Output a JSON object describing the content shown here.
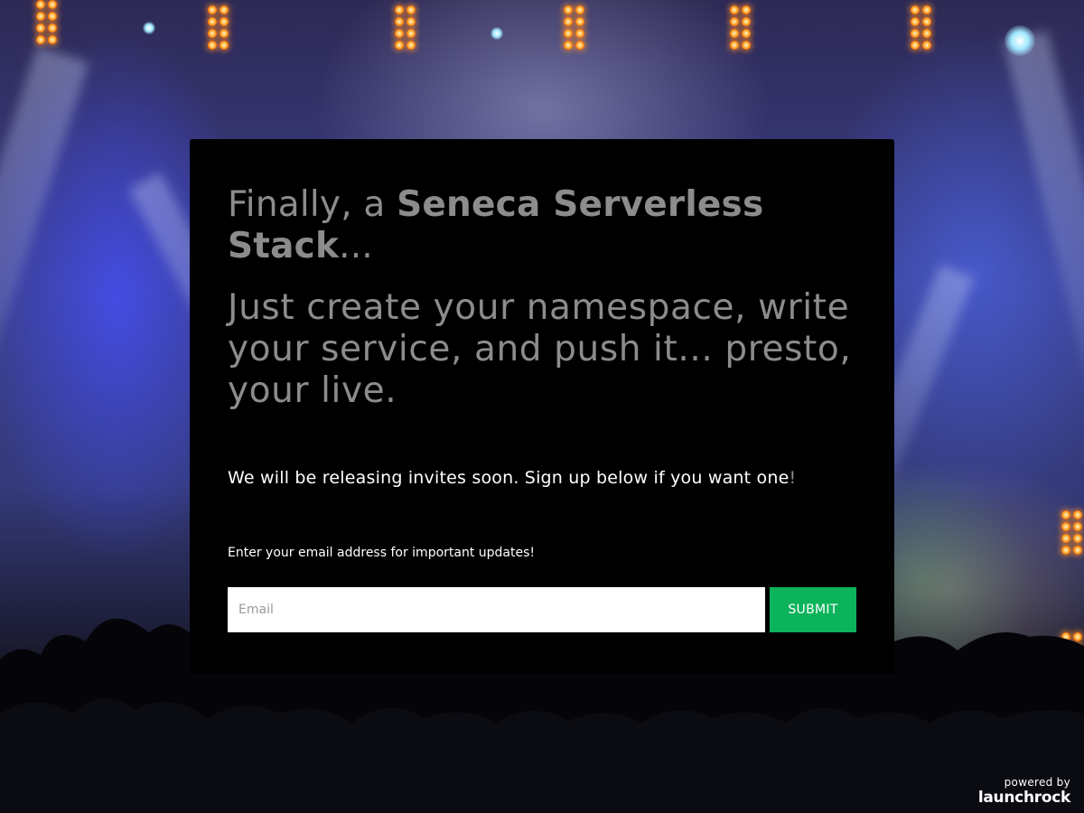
{
  "card": {
    "headline_prefix": "Finally, a ",
    "headline_bold": "Seneca Serverless Stack",
    "headline_suffix": "...",
    "subhead": "Just create your namespace, write your service, and push it... presto, your live.",
    "invite_text": "We will be releasing invites soon. Sign up below if you want one",
    "invite_bang": "!",
    "email_prompt": "Enter your email address for important updates!",
    "email_input": {
      "placeholder": "Email",
      "value": ""
    },
    "submit_label": "SUBMIT"
  },
  "footer": {
    "powered_by": "powered by",
    "brand": "launchrock"
  },
  "colors": {
    "card_background": "#000000",
    "headline": "#8c8c8c",
    "submit_button": "#0bb35a"
  },
  "icons": [
    "launchrock-logo"
  ]
}
